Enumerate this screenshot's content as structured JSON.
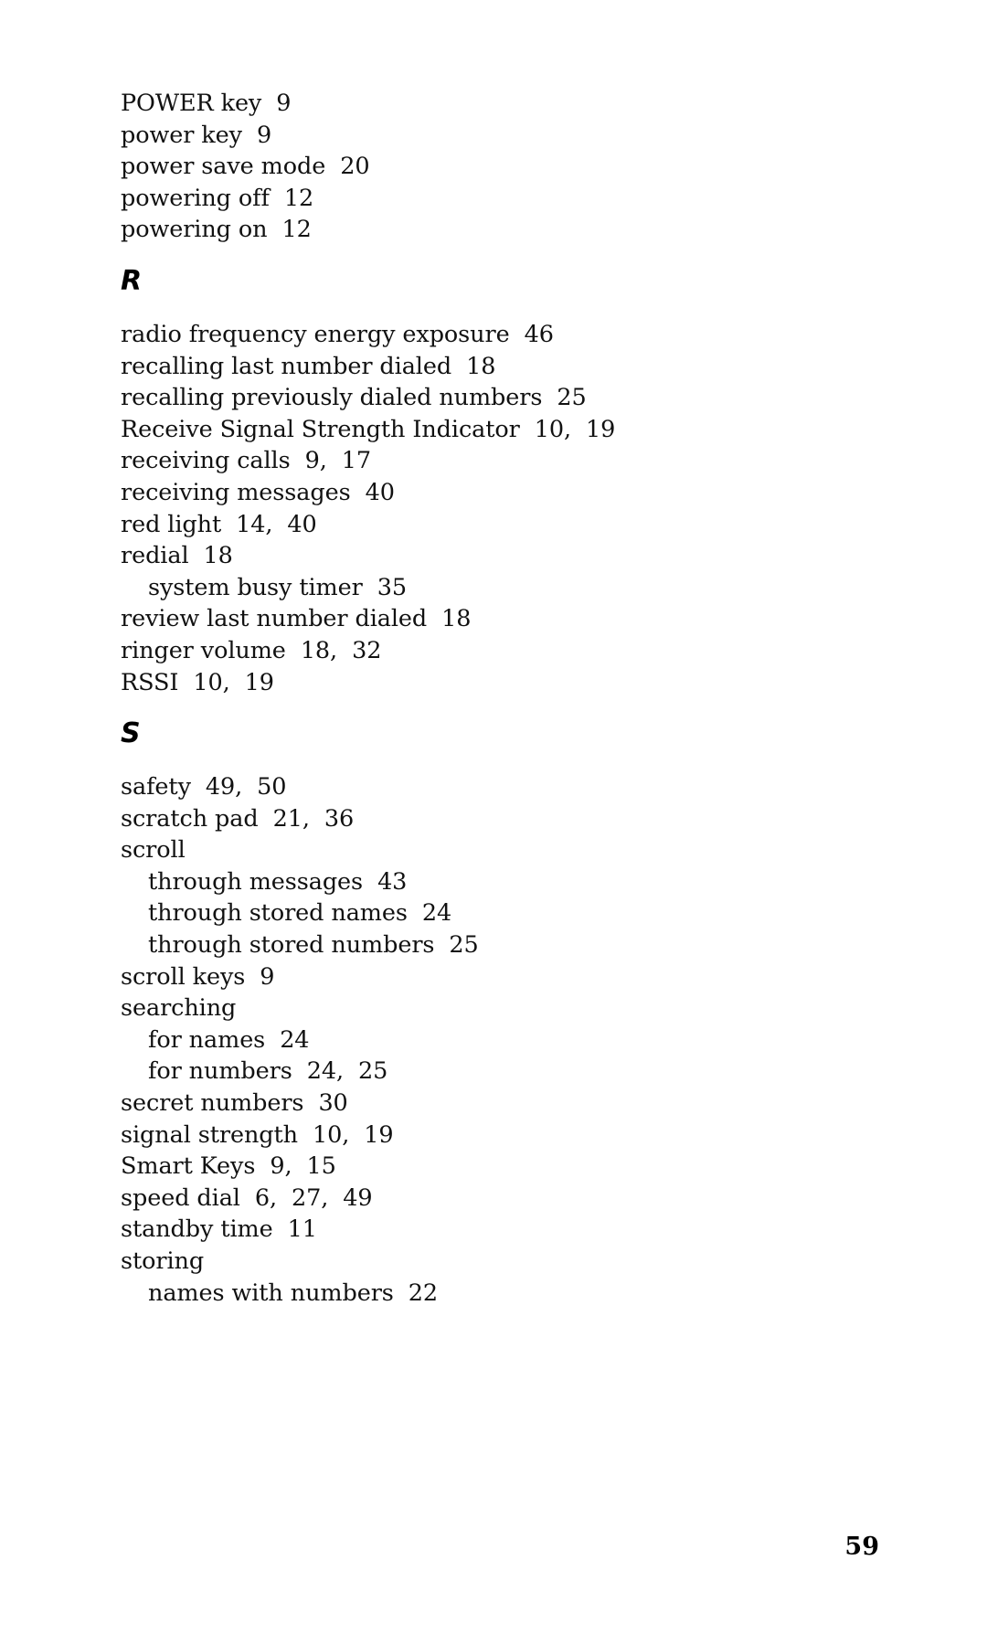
{
  "document": {
    "type": "book-index-page",
    "page_number": "59",
    "background_color": "#ffffff",
    "text_color": "#111111"
  },
  "blocks": [
    {
      "kind": "entries",
      "items": [
        {
          "level": 0,
          "term": "POWER key",
          "pages": "9"
        },
        {
          "level": 0,
          "term": "power key",
          "pages": "9"
        },
        {
          "level": 0,
          "term": "power save mode",
          "pages": "20"
        },
        {
          "level": 0,
          "term": "powering off",
          "pages": "12"
        },
        {
          "level": 0,
          "term": "powering on",
          "pages": "12"
        }
      ]
    },
    {
      "kind": "section",
      "letter": "R",
      "items": [
        {
          "level": 0,
          "term": "radio frequency energy exposure",
          "pages": "46"
        },
        {
          "level": 0,
          "term": "recalling last number dialed",
          "pages": "18"
        },
        {
          "level": 0,
          "term": "recalling previously dialed numbers",
          "pages": "25"
        },
        {
          "level": 0,
          "term": "Receive Signal Strength Indicator",
          "pages": "10,  19"
        },
        {
          "level": 0,
          "term": "receiving calls",
          "pages": "9,  17"
        },
        {
          "level": 0,
          "term": "receiving messages",
          "pages": "40"
        },
        {
          "level": 0,
          "term": "red light",
          "pages": "14,  40"
        },
        {
          "level": 0,
          "term": "redial",
          "pages": "18"
        },
        {
          "level": 1,
          "term": "system busy timer",
          "pages": "35"
        },
        {
          "level": 0,
          "term": "review last number dialed",
          "pages": "18"
        },
        {
          "level": 0,
          "term": "ringer volume",
          "pages": "18,  32"
        },
        {
          "level": 0,
          "term": "RSSI",
          "pages": "10,  19"
        }
      ]
    },
    {
      "kind": "section",
      "letter": "S",
      "items": [
        {
          "level": 0,
          "term": "safety",
          "pages": "49,  50"
        },
        {
          "level": 0,
          "term": "scratch pad",
          "pages": "21,  36"
        },
        {
          "level": 0,
          "term": "scroll",
          "pages": ""
        },
        {
          "level": 1,
          "term": "through messages",
          "pages": "43"
        },
        {
          "level": 1,
          "term": "through stored names",
          "pages": "24"
        },
        {
          "level": 1,
          "term": "through stored numbers",
          "pages": "25"
        },
        {
          "level": 0,
          "term": "scroll keys",
          "pages": "9"
        },
        {
          "level": 0,
          "term": "searching",
          "pages": ""
        },
        {
          "level": 1,
          "term": "for names",
          "pages": "24"
        },
        {
          "level": 1,
          "term": "for numbers",
          "pages": "24,  25"
        },
        {
          "level": 0,
          "term": "secret numbers",
          "pages": "30"
        },
        {
          "level": 0,
          "term": "signal strength",
          "pages": "10,  19"
        },
        {
          "level": 0,
          "term": "Smart Keys",
          "pages": "9,  15"
        },
        {
          "level": 0,
          "term": "speed dial",
          "pages": "6,  27,  49"
        },
        {
          "level": 0,
          "term": "standby time",
          "pages": "11"
        },
        {
          "level": 0,
          "term": "storing",
          "pages": ""
        },
        {
          "level": 1,
          "term": "names with numbers",
          "pages": "22"
        }
      ]
    }
  ]
}
